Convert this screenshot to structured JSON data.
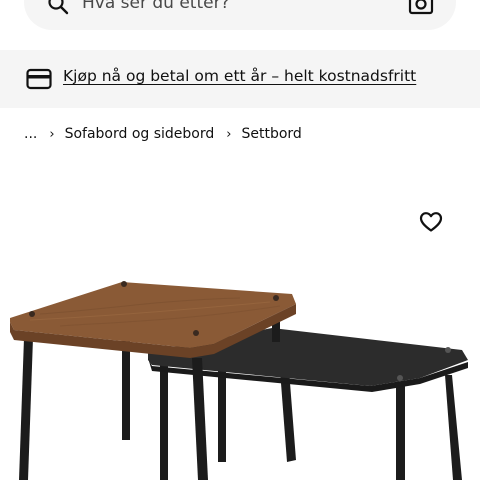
{
  "search": {
    "placeholder": "Hva ser du etter?",
    "icon": "search-icon",
    "camera_icon": "camera-icon"
  },
  "promo": {
    "icon": "credit-card-icon",
    "link_text": "Kjøp nå og betal om ett år – helt kostnadsfritt",
    "background": "#f5f5f5"
  },
  "breadcrumb": {
    "items": [
      "...",
      "Sofabord og sidebord",
      "Settbord"
    ],
    "separator": "›"
  },
  "favourite": {
    "icon": "heart-icon"
  },
  "product_image": {
    "subject": "nesting tables",
    "colors": {
      "wood_top": "#8a5a36",
      "wood_edge": "#6b4226",
      "black_top": "#2c2c2c",
      "legs": "#1c1c1c"
    }
  }
}
